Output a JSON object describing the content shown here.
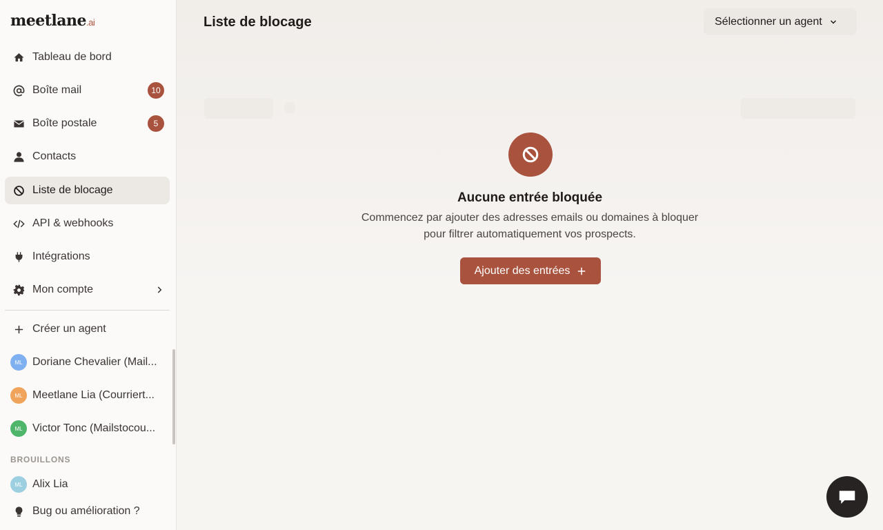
{
  "brand": {
    "name": "meetlane",
    "suffix": ".ai",
    "accent": "#a9533f"
  },
  "nav": [
    {
      "label": "Tableau de bord",
      "icon": "home-icon"
    },
    {
      "label": "Boîte mail",
      "icon": "at-icon",
      "badge": "10"
    },
    {
      "label": "Boîte postale",
      "icon": "envelope-icon",
      "badge": "5"
    },
    {
      "label": "Contacts",
      "icon": "user-icon"
    },
    {
      "label": "Liste de blocage",
      "icon": "ban-icon",
      "active": true
    },
    {
      "label": "API & webhooks",
      "icon": "code-icon"
    },
    {
      "label": "Intégrations",
      "icon": "plug-icon"
    },
    {
      "label": "Mon compte",
      "icon": "gear-icon"
    }
  ],
  "agents": {
    "create_label": "Créer un agent",
    "items": [
      {
        "initials": "ML",
        "name": "Doriane Chevalier (Mailstocou...)",
        "display": "Doriane Chevalier (Mail...",
        "color": "#7fb0f0"
      },
      {
        "initials": "ML",
        "name": "Meetlane Lia (Courriert...)",
        "display": "Meetlane Lia (Courriert...",
        "color": "#f0a35a"
      },
      {
        "initials": "ML",
        "name": "Victor Tonc (Mailstocou...)",
        "display": "Victor Tonc (Mailstocou...",
        "color": "#4fb56b"
      }
    ]
  },
  "drafts": {
    "title": "BROUILLONS",
    "items": [
      {
        "initials": "ML",
        "name": "Alix Lia",
        "color": "#9ccfe0"
      }
    ]
  },
  "feedback": {
    "label": "Bug ou amélioration ?",
    "icon": "lightbulb-icon"
  },
  "header": {
    "title": "Liste de blocage",
    "agent_select": "Sélectionner un agent"
  },
  "empty_state": {
    "icon": "ban-icon",
    "title": "Aucune entrée bloquée",
    "description": "Commencez par ajouter des adresses emails ou domaines à bloquer pour filtrer automatiquement vos prospects.",
    "button_label": "Ajouter des entrées"
  },
  "chat": {
    "icon": "chat-icon"
  }
}
